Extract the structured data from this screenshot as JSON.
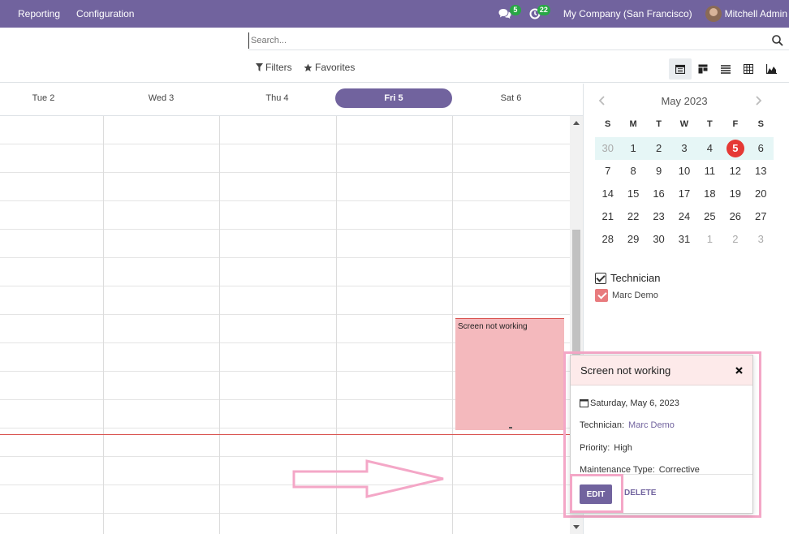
{
  "navbar": {
    "menu": [
      "Reporting",
      "Configuration"
    ],
    "messages_count": "5",
    "activities_count": "22",
    "company": "My Company (San Francisco)",
    "user": "Mitchell Admin"
  },
  "search": {
    "placeholder": "Search..."
  },
  "filters": {
    "filters_label": "Filters",
    "favorites_label": "Favorites"
  },
  "views": [
    "calendar-icon",
    "kanban-icon",
    "list-icon",
    "pivot-icon",
    "graph-icon"
  ],
  "calendar": {
    "days": [
      "Tue 2",
      "Wed 3",
      "Thu 4",
      "Fri 5",
      "Sat 6"
    ],
    "today": "Fri 5",
    "event": {
      "title": "Screen not working",
      "color": "#f4b9bd"
    }
  },
  "mini_calendar": {
    "title": "May 2023",
    "weekdays": [
      "S",
      "M",
      "T",
      "W",
      "T",
      "F",
      "S"
    ],
    "weeks": [
      [
        "30",
        "1",
        "2",
        "3",
        "4",
        "5",
        "6"
      ],
      [
        "7",
        "8",
        "9",
        "10",
        "11",
        "12",
        "13"
      ],
      [
        "14",
        "15",
        "16",
        "17",
        "18",
        "19",
        "20"
      ],
      [
        "21",
        "22",
        "23",
        "24",
        "25",
        "26",
        "27"
      ],
      [
        "28",
        "29",
        "30",
        "31",
        "1",
        "2",
        "3"
      ]
    ],
    "today": "5"
  },
  "sidebar_filter": {
    "heading": "Technician",
    "items": [
      "Marc Demo"
    ]
  },
  "popover": {
    "title": "Screen not working",
    "date": "Saturday, May 6, 2023",
    "technician_label": "Technician:",
    "technician_value": "Marc Demo",
    "priority_label": "Priority:",
    "priority_value": "High",
    "type_label": "Maintenance Type:",
    "type_value": "Corrective",
    "edit_label": "EDIT",
    "delete_label": "DELETE"
  },
  "colors": {
    "brand": "#71639e",
    "today_red": "#e53935",
    "annotation": "#f4a7c7"
  }
}
